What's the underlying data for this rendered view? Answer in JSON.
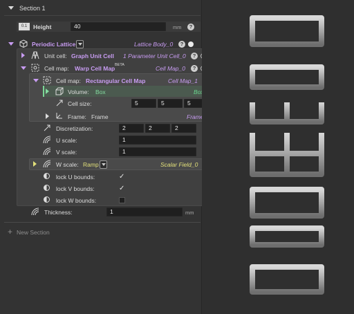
{
  "section1": {
    "title": "Section 1"
  },
  "height": {
    "type_label": "0.1",
    "label": "Height",
    "value": "40",
    "unit": "mm"
  },
  "periodic_lattice": {
    "label": "Periodic Lattice",
    "name": "Lattice Body_0"
  },
  "unit_cell": {
    "label": "Unit cell:",
    "value": "Graph Unit Cell",
    "name": "1 Parameter Unit Cell_0"
  },
  "cell_map_warp": {
    "label": "Cell map:",
    "value": "Warp Cell Map",
    "badge": "BETA",
    "name": "Cell Map_0"
  },
  "cell_map_rect": {
    "label": "Cell map:",
    "value": "Rectangular Cell Map",
    "name": "Cell Map_1"
  },
  "volume": {
    "label": "Volume:",
    "value": "Box",
    "name": "Box_0"
  },
  "cell_size": {
    "label": "Cell size:",
    "values": [
      "5",
      "5",
      "5"
    ],
    "unit": "mm"
  },
  "frame": {
    "label": "Frame:",
    "value": "Frame",
    "name": "Frame_0"
  },
  "discretization": {
    "label": "Discretization:",
    "values": [
      "2",
      "2",
      "2"
    ]
  },
  "u_scale": {
    "label": "U scale:",
    "value": "1"
  },
  "v_scale": {
    "label": "V scale:",
    "value": "1"
  },
  "w_scale": {
    "label": "W scale:",
    "value": "Ramp",
    "name": "Scalar Field_0"
  },
  "lock_u": {
    "label": "lock U bounds:",
    "checked": true
  },
  "lock_v": {
    "label": "lock V bounds:",
    "checked": true
  },
  "lock_w": {
    "label": "lock W bounds:",
    "checked": false
  },
  "thickness": {
    "label": "Thickness:",
    "value": "1",
    "unit": "mm"
  },
  "new_section": {
    "label": "New Section"
  },
  "icons": {
    "help": "?",
    "check": "✓"
  },
  "colors": {
    "purple": "#c89cf2",
    "green": "#84dca0",
    "yellow": "#e2e07a",
    "lattice_gray": "#a9a9a9"
  }
}
